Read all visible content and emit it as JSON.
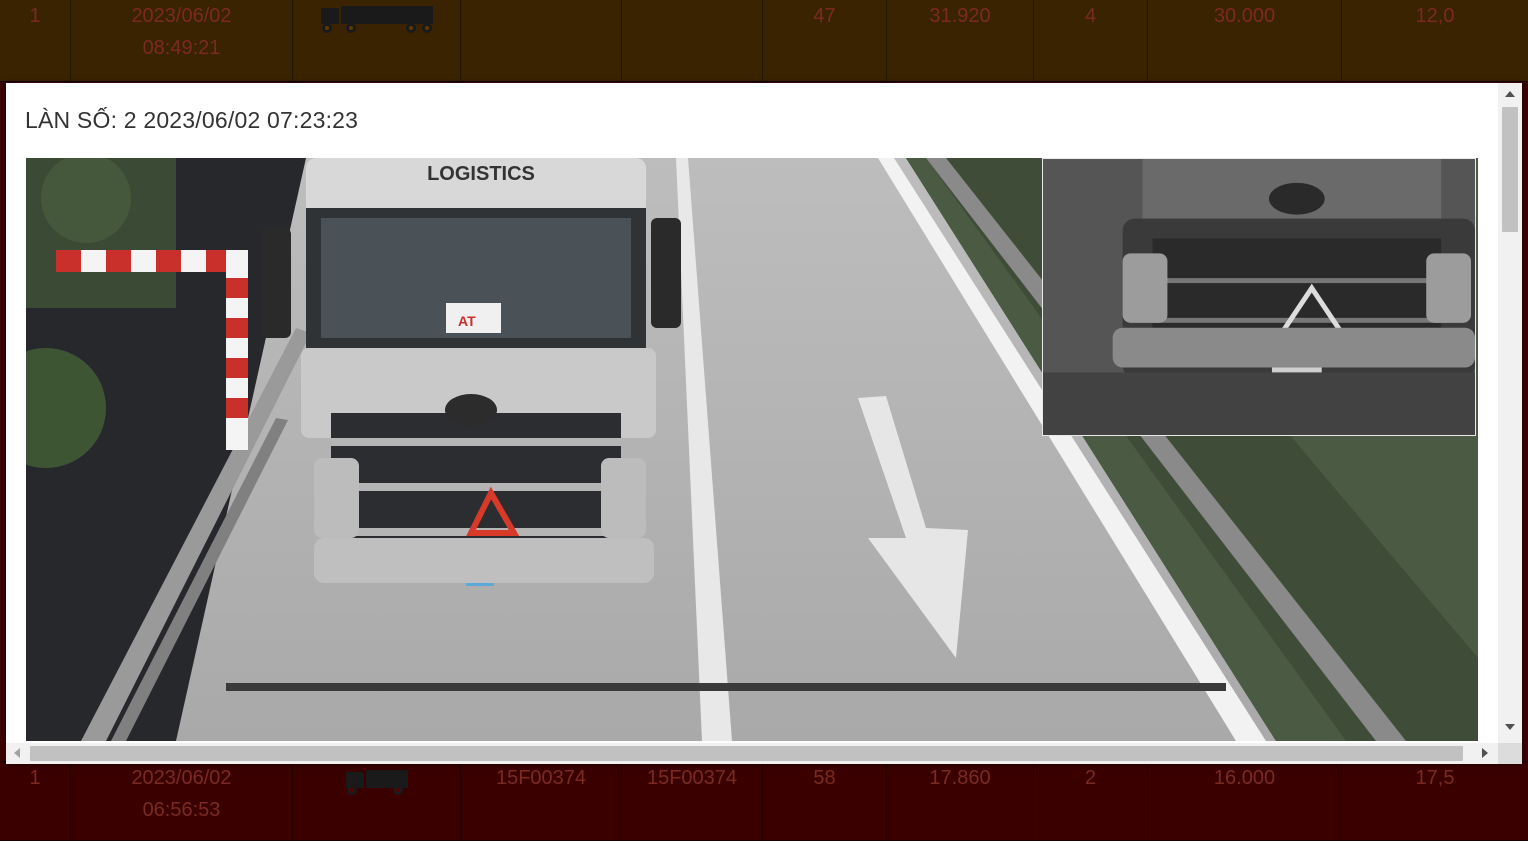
{
  "table_rows": {
    "top": {
      "index": "1",
      "date": "2023/06/02",
      "time": "08:49:21",
      "vehicle_icon": "truck-trailer-icon",
      "plate_front": "",
      "plate_rear": "",
      "col_a": "47",
      "gross": "31.920",
      "axles": "4",
      "allowed": "30.000",
      "percent": "12,0"
    },
    "bottom": {
      "index": "1",
      "date": "2023/06/02",
      "time": "06:56:53",
      "vehicle_icon": "truck-icon",
      "plate_front": "15F00374",
      "plate_rear": "15F00374",
      "col_a": "58",
      "gross": "17.860",
      "axles": "2",
      "allowed": "16.000",
      "percent": "17,5"
    }
  },
  "modal": {
    "title": "LÀN SỐ: 2 2023/06/02 07:23:23",
    "photo_label": "LOGISTICS",
    "windshield_sticker": "AT",
    "inset_description_icon": "front-camera-icon"
  },
  "colors": {
    "row_highlight": "#3a2300",
    "row_alert": "#3a0000",
    "row_text": "#7b2a22"
  }
}
